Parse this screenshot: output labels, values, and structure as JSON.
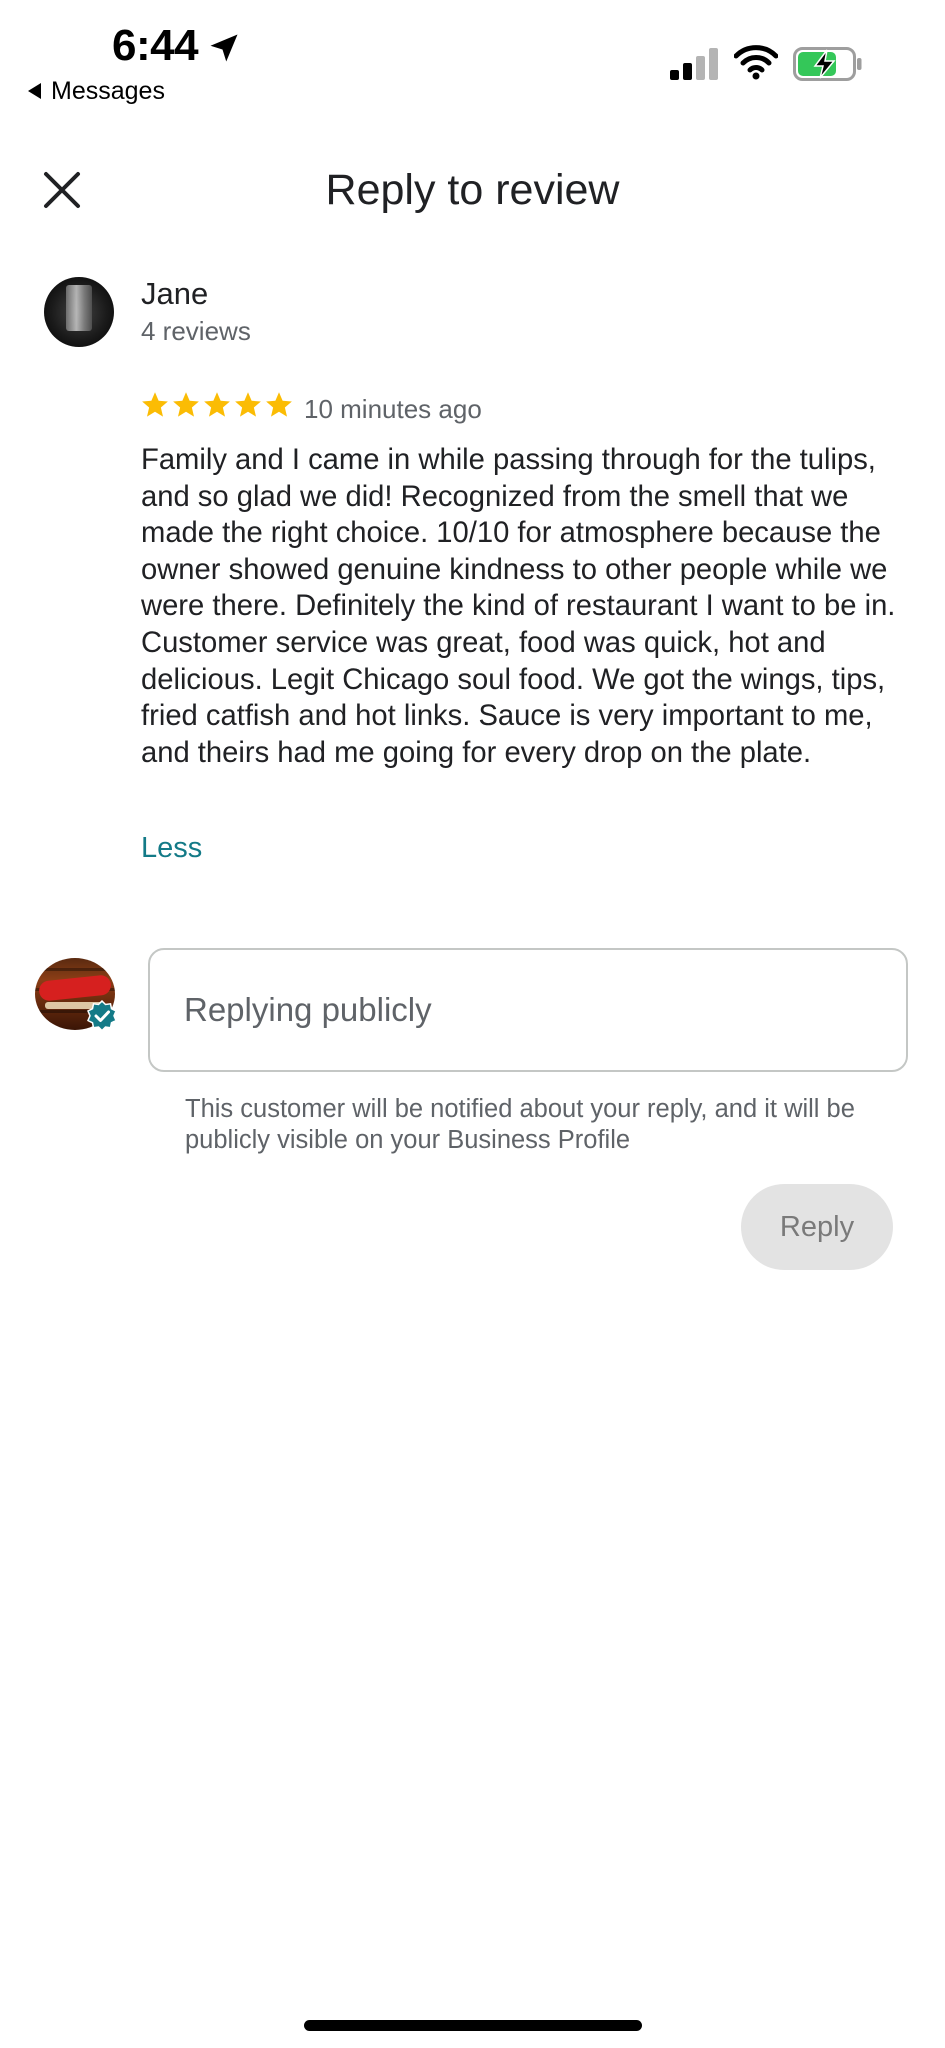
{
  "status_bar": {
    "time": "6:44",
    "back_app": "Messages",
    "battery_color": "#34c759"
  },
  "header": {
    "title": "Reply to review"
  },
  "review": {
    "reviewer_name": "Jane",
    "reviewer_review_count": "4 reviews",
    "rating": 5,
    "max_rating": 5,
    "star_color": "#fbbc04",
    "time_ago": "10 minutes ago",
    "text": "Family and I came in while passing through for the tulips, and so glad we did! Recognized from the smell that we made the right choice. 10/10 for atmosphere because the owner showed genuine kindness to other people while we were there. Definitely the kind of restaurant I want to be in. Customer service was great, food was quick, hot and delicious. Legit Chicago soul food. We got the wings, tips, fried catfish and hot links. Sauce is very important to me, and theirs had me going for every drop on the plate.",
    "toggle_label": "Less",
    "link_color": "#137a87"
  },
  "reply": {
    "placeholder": "Replying publicly",
    "value": "",
    "notice": "This customer will be notified about your reply, and it will be publicly visible on your Business Profile",
    "button_label": "Reply",
    "button_enabled": false
  },
  "icons": {
    "close": "close-icon",
    "location": "location-arrow-icon",
    "signal": "cellular-signal-icon",
    "wifi": "wifi-icon",
    "battery": "battery-charging-icon",
    "star": "star-icon",
    "verified": "verified-badge-icon"
  }
}
